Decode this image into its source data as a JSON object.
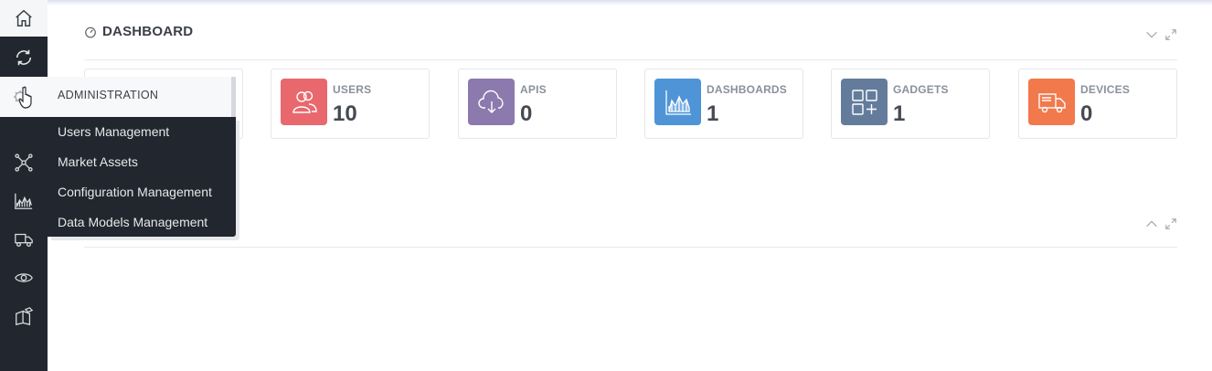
{
  "dashboard": {
    "title": "DASHBOARD"
  },
  "admin_menu": {
    "header": "ADMINISTRATION",
    "items": [
      {
        "label": "Users Management"
      },
      {
        "label": "Market Assets"
      },
      {
        "label": "Configuration Management"
      },
      {
        "label": "Data Models Management"
      }
    ]
  },
  "cards": [
    {
      "label": "USERS",
      "value": "10",
      "color": "#e8686e",
      "icon": "users-icon"
    },
    {
      "label": "APIS",
      "value": "0",
      "color": "#8c79ad",
      "icon": "cloud-download-icon"
    },
    {
      "label": "DASHBOARDS",
      "value": "1",
      "color": "#4e94d6",
      "icon": "area-chart-icon"
    },
    {
      "label": "GADGETS",
      "value": "1",
      "color": "#647c9c",
      "icon": "grid-plus-icon"
    },
    {
      "label": "DEVICES",
      "value": "0",
      "color": "#f2794b",
      "icon": "truck-icon"
    }
  ],
  "sidebar": {
    "items": [
      "home-icon",
      "sync-icon",
      "settings-icon",
      "network-icon",
      "area-chart-icon",
      "truck-icon",
      "eye-icon",
      "boxes-icon"
    ]
  }
}
